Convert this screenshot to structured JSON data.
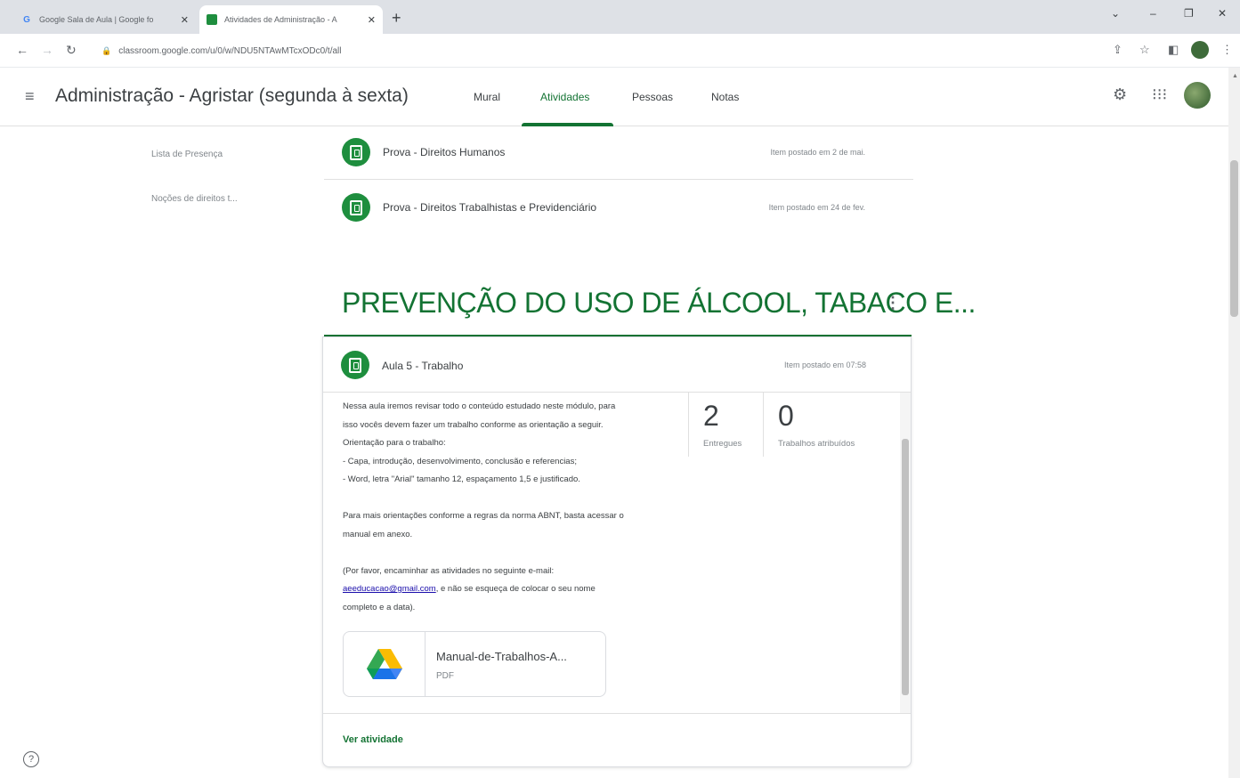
{
  "browser": {
    "tabs": [
      {
        "title": "Google Sala de Aula | Google fo",
        "icon": "google-g-icon"
      },
      {
        "title": "Atividades de Administração - A",
        "icon": "classroom-icon"
      }
    ],
    "url": "classroom.google.com/u/0/w/NDU5NTAwMTcxODc0/t/all"
  },
  "header": {
    "class_title": "Administração - Agristar (segunda à sexta)",
    "tabs": [
      "Mural",
      "Atividades",
      "Pessoas",
      "Notas"
    ],
    "active_tab": "Atividades"
  },
  "topics": [
    "Lista de Presença",
    "Noções de direitos t..."
  ],
  "items_top": [
    {
      "title": "Prova - Direitos Humanos",
      "posted": "Item postado em 2 de mai."
    },
    {
      "title": "Prova - Direitos Trabalhistas e Previdenciário",
      "posted": "Item postado em 24 de fev."
    }
  ],
  "section": {
    "title": "PREVENÇÃO DO USO DE ÁLCOOL, TABACO E...",
    "menu_icon": "more-vert-icon"
  },
  "assignment": {
    "title": "Aula 5 - Trabalho",
    "posted": "Item postado em 07:58",
    "description": [
      "Nessa aula iremos revisar todo o conteúdo estudado neste módulo, para",
      "isso vocês devem fazer um trabalho conforme as orientação a seguir.",
      "Orientação para o trabalho:",
      "- Capa, introdução, desenvolvimento, conclusão e referencias;",
      "- Word, letra \"Arial\" tamanho 12, espaçamento 1,5 e justificado.",
      "",
      "Para mais orientações conforme a regras da norma ABNT, basta acessar o",
      "manual em anexo.",
      "",
      "(Por favor, encaminhar as atividades no seguinte e-mail:"
    ],
    "email": "aeeducacao@gmail.com",
    "email_suffix": ", e não se esqueça de colocar o seu nome",
    "description_end": "completo e a data).",
    "stats": [
      {
        "value": "2",
        "label": "Entregues"
      },
      {
        "value": "0",
        "label": "Trabalhos atribuídos"
      }
    ],
    "attachment": {
      "title": "Manual-de-Trabalhos-A...",
      "type": "PDF"
    },
    "view_link": "Ver atividade"
  },
  "help_icon": "help-icon"
}
